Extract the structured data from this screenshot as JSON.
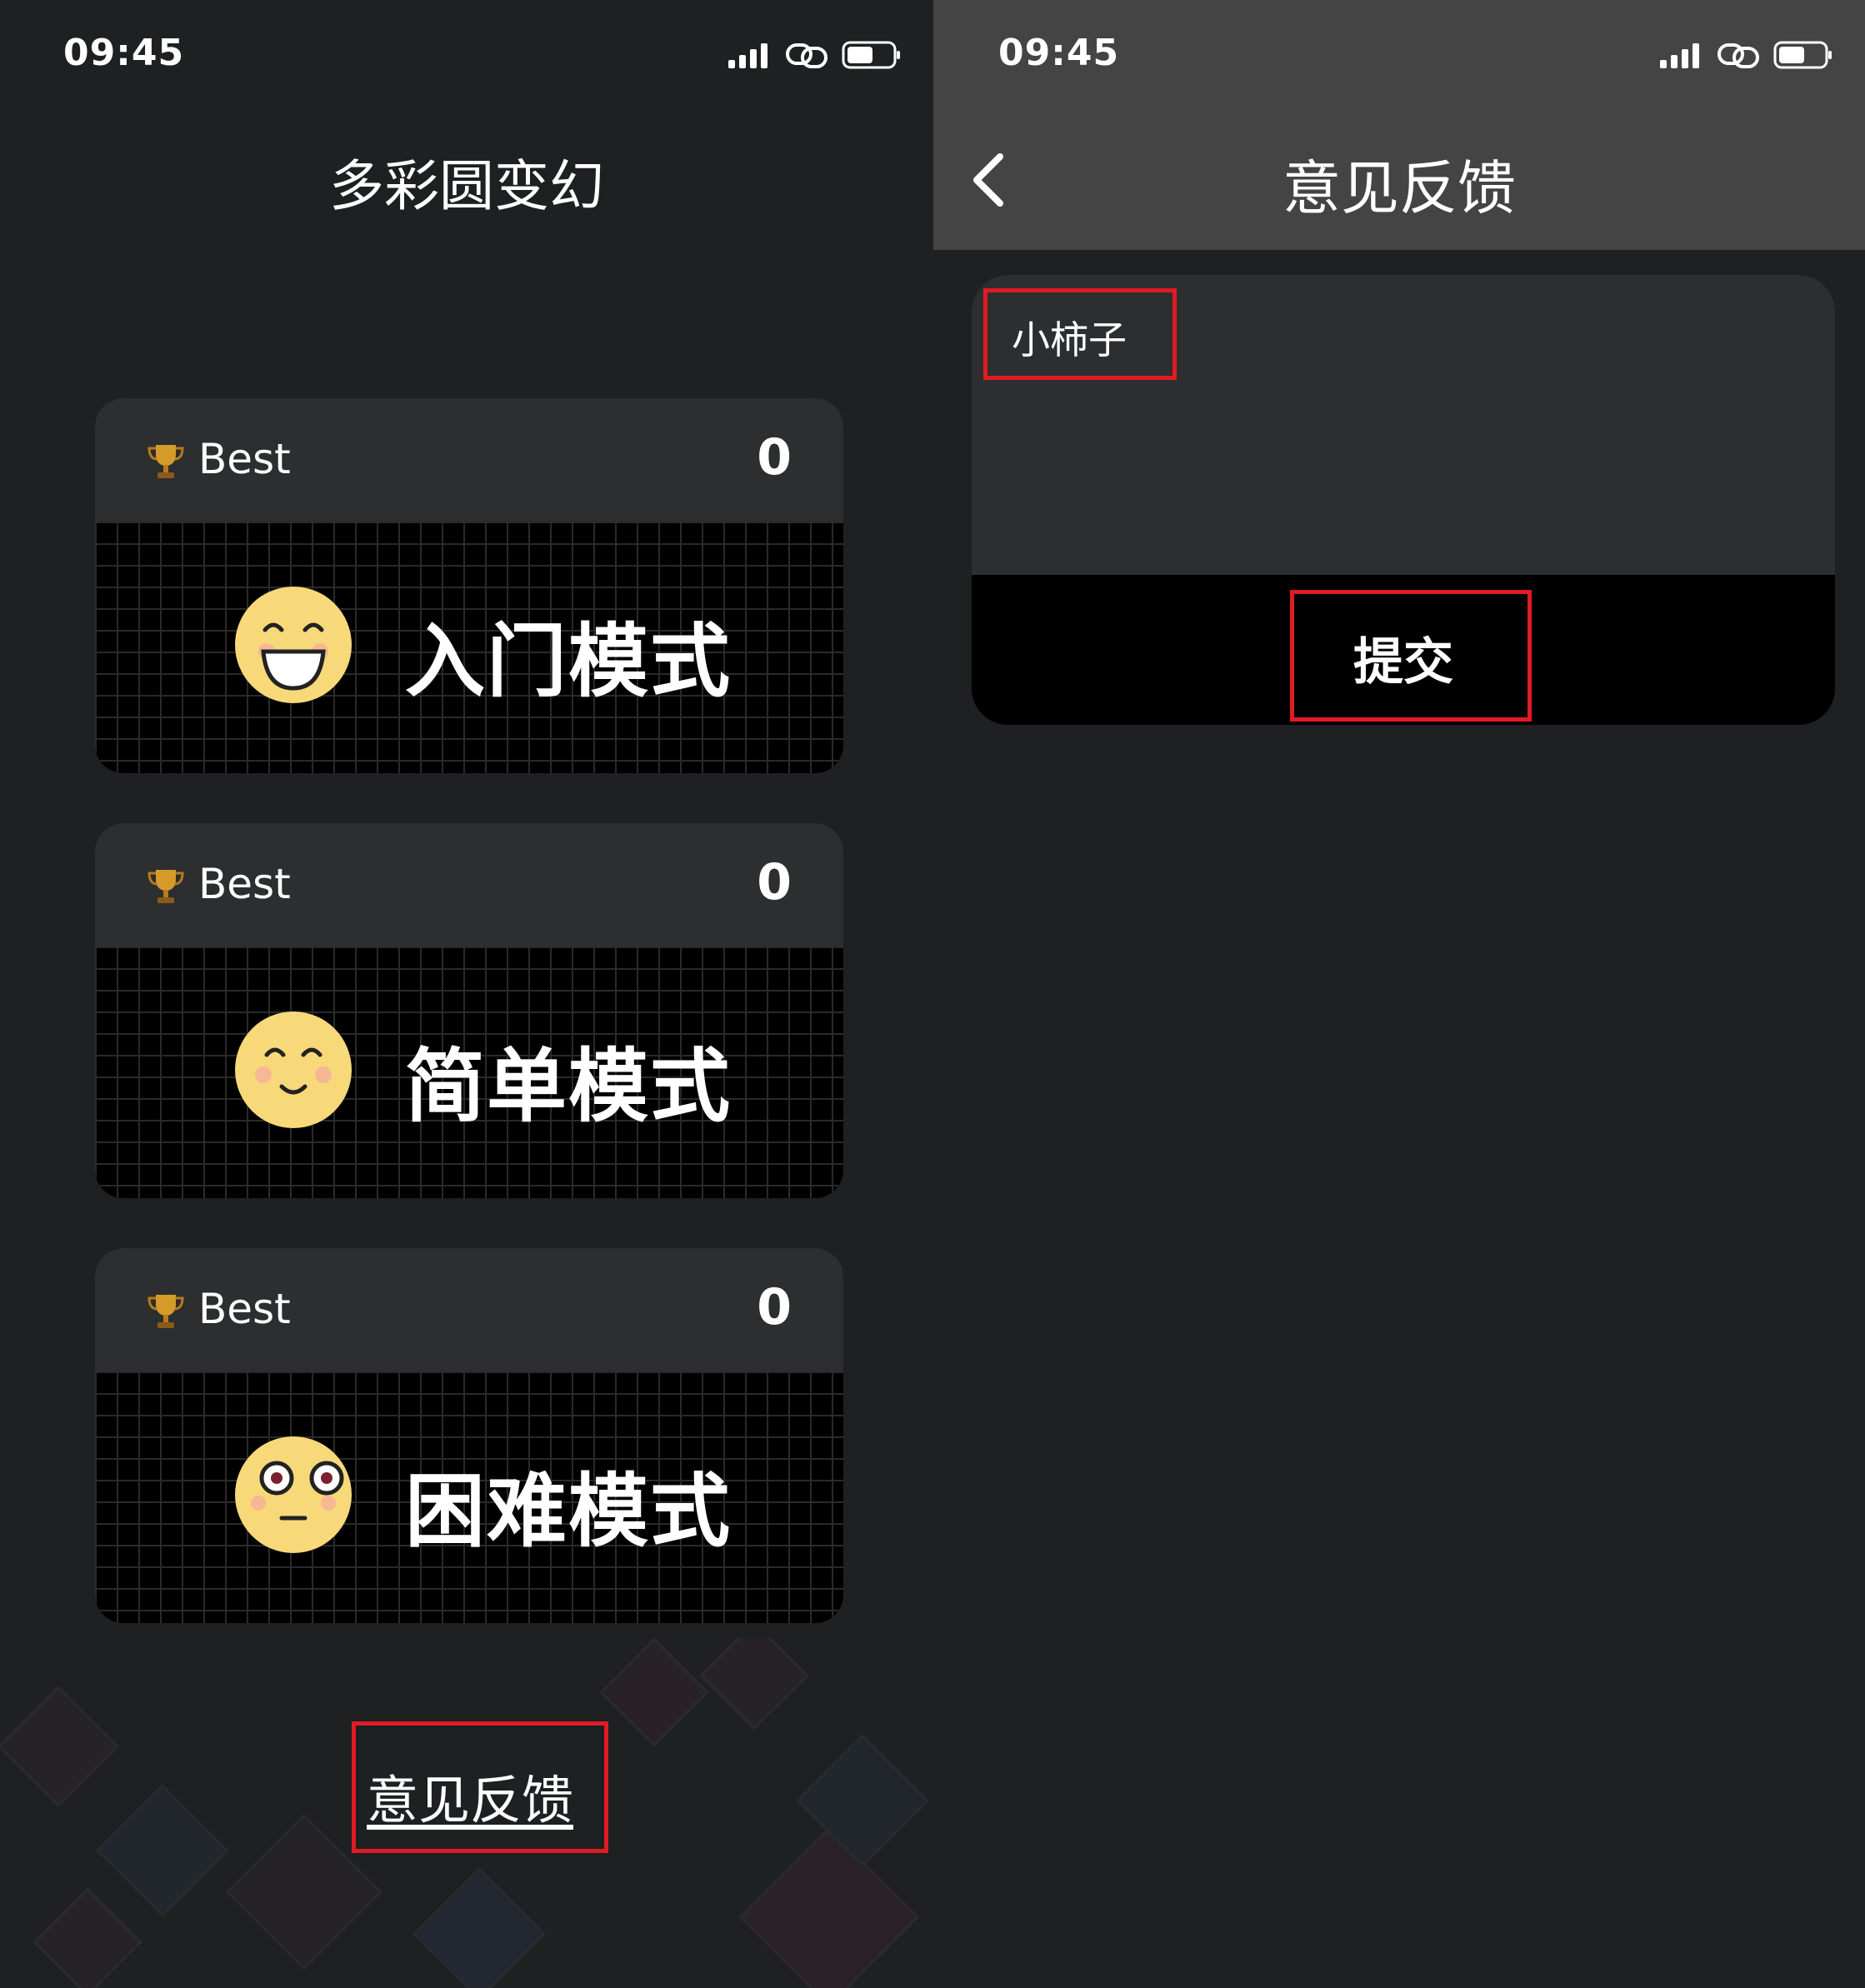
{
  "left_screen": {
    "status": {
      "time": "09:45"
    },
    "title": "多彩圆变幻",
    "modes": [
      {
        "best_label": "Best",
        "best_score": "0",
        "name": "入门模式",
        "face": "grinning-face-icon"
      },
      {
        "best_label": "Best",
        "best_score": "0",
        "name": "简单模式",
        "face": "smiling-face-icon"
      },
      {
        "best_label": "Best",
        "best_score": "0",
        "name": "困难模式",
        "face": "wide-eyed-face-icon"
      }
    ],
    "feedback_link": "意见反馈"
  },
  "right_screen": {
    "status": {
      "time": "09:45"
    },
    "nav_title": "意见反馈",
    "feedback_text": "小柿子",
    "submit_label": "提交"
  },
  "colors": {
    "background": "#1e2022",
    "card_header": "#2c2e30",
    "nav_bar": "#444444",
    "highlight": "#e01b24",
    "face": "#f7d97a"
  }
}
